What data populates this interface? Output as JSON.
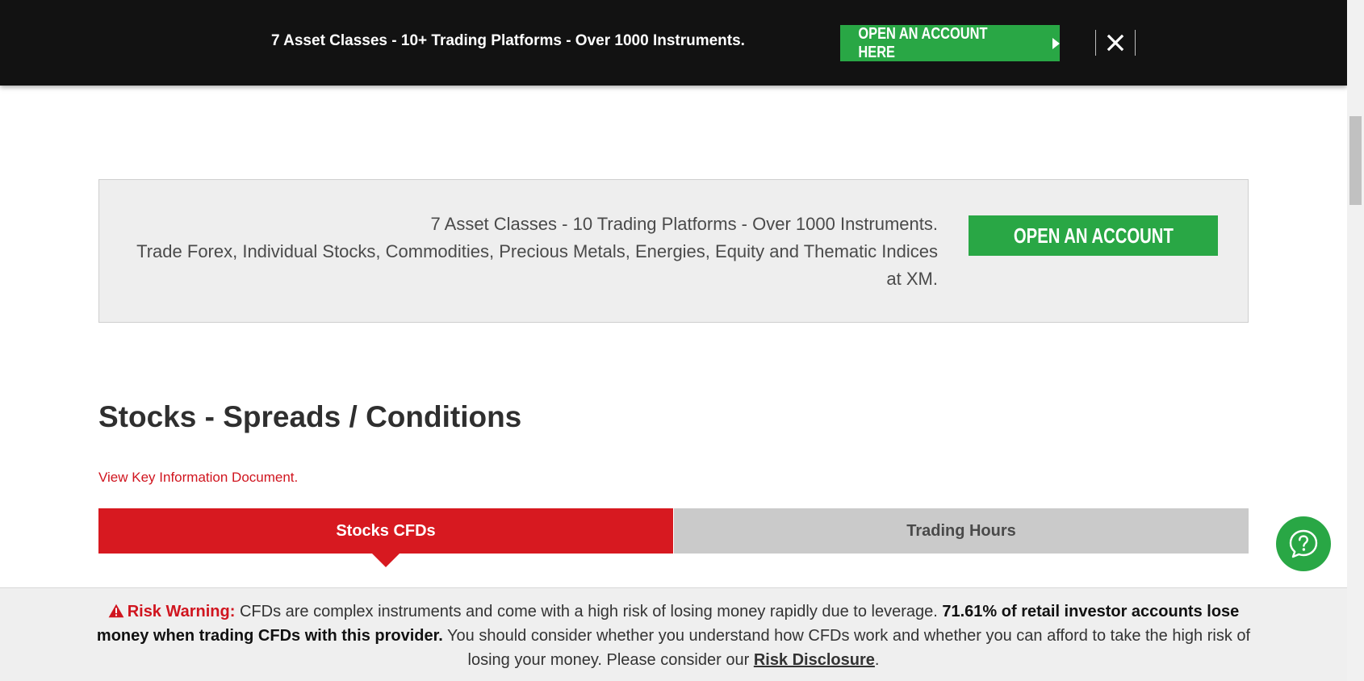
{
  "topbar": {
    "text": "7 Asset Classes - 10+ Trading Platforms - Over 1000 Instruments.",
    "button_label": "OPEN AN ACCOUNT HERE",
    "icons": {
      "arrow": "play-triangle-icon",
      "close": "close-icon"
    }
  },
  "promo": {
    "line1": "7 Asset Classes - 10 Trading Platforms - Over 1000 Instruments.",
    "line2": "Trade Forex, Individual Stocks, Commodities, Precious Metals, Energies, Equity and Thematic Indices at XM.",
    "button_label": "OPEN AN ACCOUNT"
  },
  "page": {
    "title": "Stocks - Spreads / Conditions",
    "kid_link": "View Key Information Document."
  },
  "tabs": [
    {
      "label": "Stocks CFDs",
      "active": true
    },
    {
      "label": "Trading Hours",
      "active": false
    }
  ],
  "risk": {
    "label": "Risk Warning:",
    "text1": " CFDs are complex instruments and come with a high risk of losing money rapidly due to leverage. ",
    "bold": "71.61% of retail investor accounts lose money when trading CFDs with this provider.",
    "text2": " You should consider whether you understand how CFDs work and whether you can afford to take the high risk of losing your money. Please consider our ",
    "link": "Risk Disclosure",
    "end": "."
  },
  "colors": {
    "brand_green": "#29a745",
    "brand_red": "#d71920",
    "topbar_bg": "#121212"
  },
  "help": {
    "icon": "question-circle-icon"
  }
}
